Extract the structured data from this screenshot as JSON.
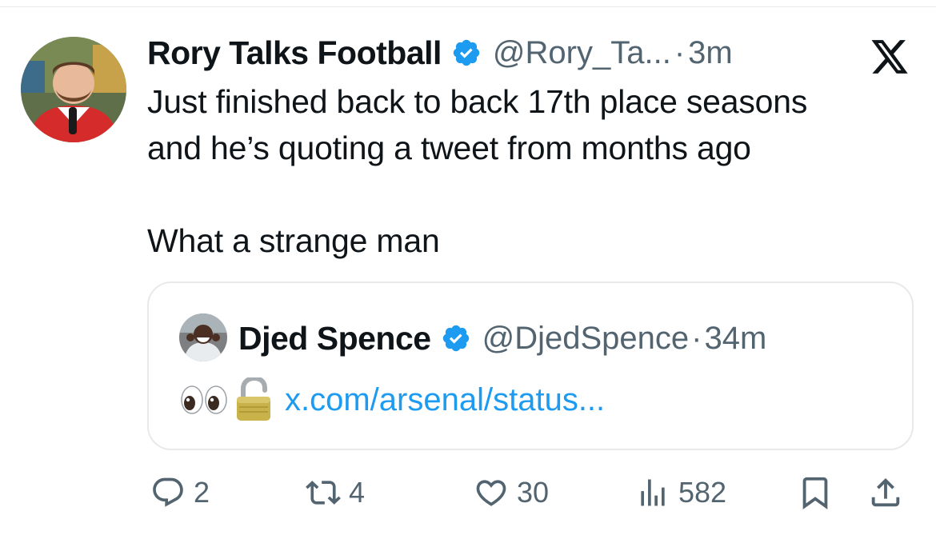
{
  "tweet": {
    "author_name": "Rory Talks Football",
    "handle": "@Rory_Ta...",
    "separator": "·",
    "time": "3m",
    "text_lines": [
      "Just finished back to back 17th place seasons",
      "and he’s quoting a tweet from months ago",
      "What a strange man"
    ]
  },
  "quote": {
    "author_name": "Djed Spence",
    "handle": "@DjedSpence",
    "separator": "·",
    "time": "34m",
    "emojis": [
      "eyes-emoji",
      "unlocked-padlock-emoji"
    ],
    "link_text": "x.com/arsenal/status..."
  },
  "actions": {
    "replies": "2",
    "reposts": "4",
    "likes": "30",
    "views": "582"
  },
  "icons": {
    "verified": "verified-badge-icon",
    "x_logo": "x-logo-icon",
    "reply": "reply-icon",
    "repost": "repost-icon",
    "like": "heart-icon",
    "views": "views-icon",
    "bookmark": "bookmark-icon",
    "share": "share-icon"
  },
  "colors": {
    "verified_blue": "#1d9bf0",
    "link_blue": "#1d9bf0",
    "secondary_text": "#536471",
    "primary_text": "#0f1419",
    "border": "#e7e9ea"
  }
}
